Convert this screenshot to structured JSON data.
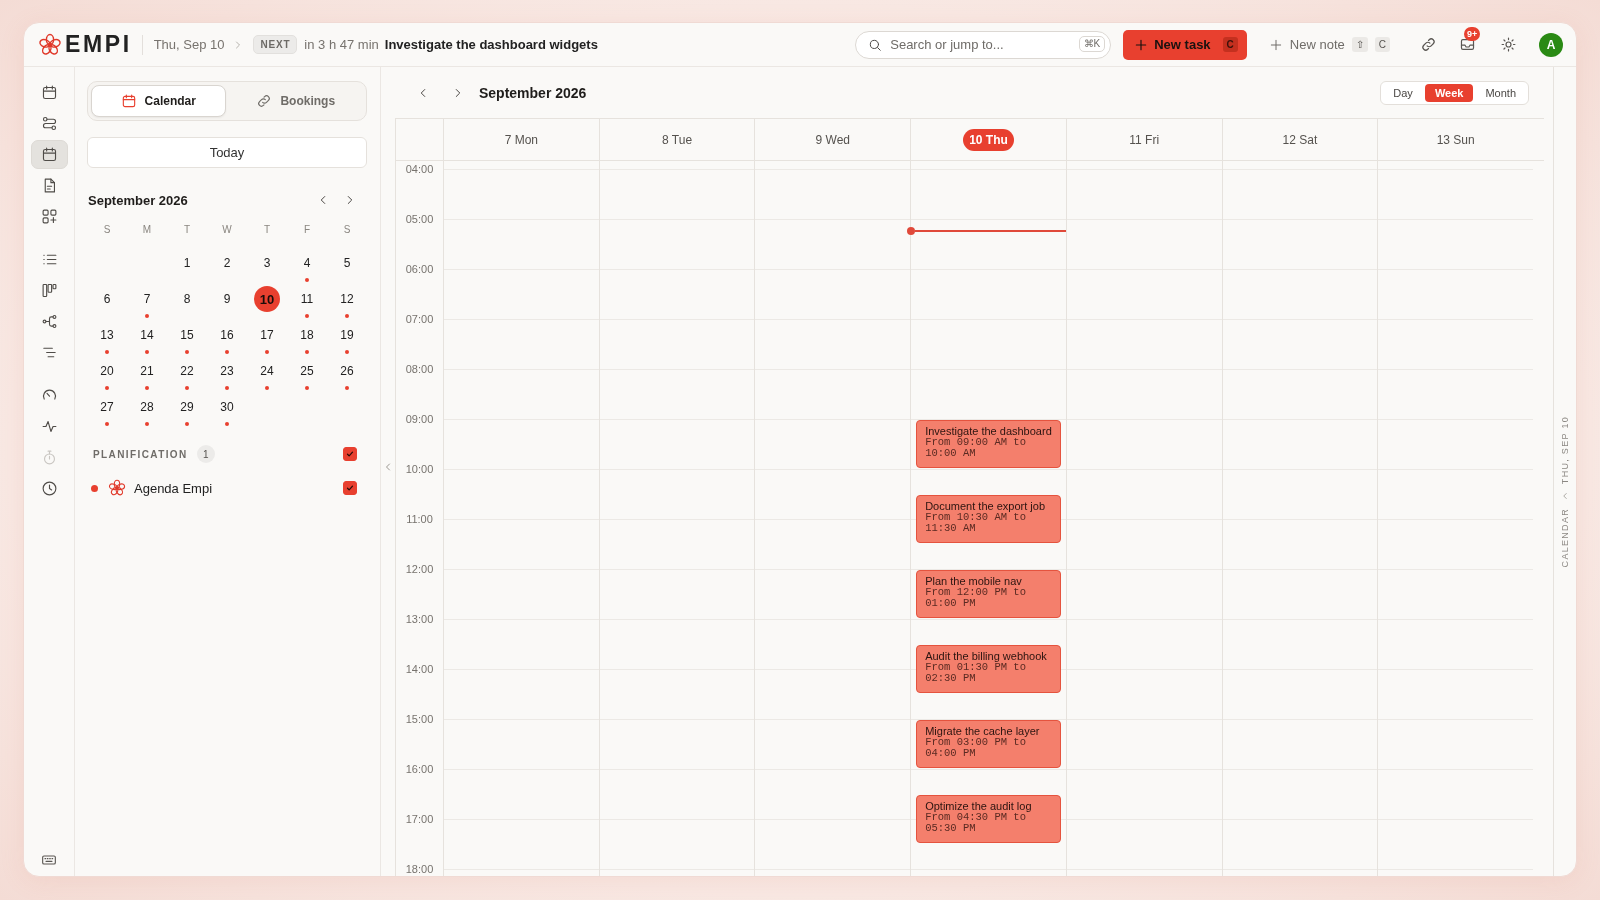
{
  "topbar": {
    "logo": "EMPI",
    "date": "Thu, Sep 10",
    "next_badge": "NEXT",
    "next_in": "in 3 h 47 min",
    "next_title": "Investigate the dashboard widgets",
    "search": {
      "placeholder": "Search or jump to...",
      "shortcut": "⌘K"
    },
    "new_task": {
      "label": "New task",
      "shortcut": "C"
    },
    "new_note": {
      "label": "New note",
      "shortcut": [
        "⇧",
        "C"
      ]
    },
    "notifications_badge": "9+",
    "avatar": "A"
  },
  "rail": {
    "groups": [
      {
        "items": [
          {
            "selected": false,
            "disabled": false
          },
          {
            "selected": false,
            "disabled": false
          },
          {
            "selected": true,
            "disabled": false
          },
          {
            "selected": false,
            "disabled": false
          },
          {
            "selected": false,
            "disabled": false
          }
        ]
      },
      {
        "items": [
          {
            "selected": false,
            "disabled": false
          },
          {
            "selected": false,
            "disabled": false
          },
          {
            "selected": false,
            "disabled": false
          },
          {
            "selected": false,
            "disabled": false
          }
        ]
      },
      {
        "items": [
          {
            "selected": false,
            "disabled": false
          },
          {
            "selected": false,
            "disabled": false
          },
          {
            "selected": false,
            "disabled": true
          },
          {
            "selected": false,
            "disabled": false
          }
        ]
      }
    ]
  },
  "sidebar": {
    "tabs": [
      {
        "label": "Calendar",
        "selected": true
      },
      {
        "label": "Bookings",
        "selected": false
      }
    ],
    "today_button": "Today",
    "mini_calendar": {
      "title": "September 2026",
      "weekdays": [
        "S",
        "M",
        "T",
        "W",
        "T",
        "F",
        "S"
      ],
      "weeks": [
        [
          {
            "kind": "blank"
          },
          {
            "kind": "blank"
          },
          {
            "kind": "day",
            "label": "1",
            "selected": false,
            "has_events": false
          },
          {
            "kind": "day",
            "label": "2",
            "selected": false,
            "has_events": false
          },
          {
            "kind": "day",
            "label": "3",
            "selected": false,
            "has_events": false
          },
          {
            "kind": "day",
            "label": "4",
            "selected": false,
            "has_events": true
          },
          {
            "kind": "day",
            "label": "5",
            "selected": false,
            "has_events": false
          }
        ],
        [
          {
            "kind": "day",
            "label": "6",
            "selected": false,
            "has_events": false
          },
          {
            "kind": "day",
            "label": "7",
            "selected": false,
            "has_events": true
          },
          {
            "kind": "day",
            "label": "8",
            "selected": false,
            "has_events": false
          },
          {
            "kind": "day",
            "label": "9",
            "selected": false,
            "has_events": false
          },
          {
            "kind": "day",
            "label": "10",
            "selected": true,
            "has_events": false
          },
          {
            "kind": "day",
            "label": "11",
            "selected": false,
            "has_events": true
          },
          {
            "kind": "day",
            "label": "12",
            "selected": false,
            "has_events": true
          }
        ],
        [
          {
            "kind": "day",
            "label": "13",
            "selected": false,
            "has_events": true
          },
          {
            "kind": "day",
            "label": "14",
            "selected": false,
            "has_events": true
          },
          {
            "kind": "day",
            "label": "15",
            "selected": false,
            "has_events": true
          },
          {
            "kind": "day",
            "label": "16",
            "selected": false,
            "has_events": true
          },
          {
            "kind": "day",
            "label": "17",
            "selected": false,
            "has_events": true
          },
          {
            "kind": "day",
            "label": "18",
            "selected": false,
            "has_events": true
          },
          {
            "kind": "day",
            "label": "19",
            "selected": false,
            "has_events": true
          }
        ],
        [
          {
            "kind": "day",
            "label": "20",
            "selected": false,
            "has_events": true
          },
          {
            "kind": "day",
            "label": "21",
            "selected": false,
            "has_events": true
          },
          {
            "kind": "day",
            "label": "22",
            "selected": false,
            "has_events": true
          },
          {
            "kind": "day",
            "label": "23",
            "selected": false,
            "has_events": true
          },
          {
            "kind": "day",
            "label": "24",
            "selected": false,
            "has_events": true
          },
          {
            "kind": "day",
            "label": "25",
            "selected": false,
            "has_events": true
          },
          {
            "kind": "day",
            "label": "26",
            "selected": false,
            "has_events": true
          }
        ],
        [
          {
            "kind": "day",
            "label": "27",
            "selected": false,
            "has_events": true
          },
          {
            "kind": "day",
            "label": "28",
            "selected": false,
            "has_events": true
          },
          {
            "kind": "day",
            "label": "29",
            "selected": false,
            "has_events": true
          },
          {
            "kind": "day",
            "label": "30",
            "selected": false,
            "has_events": true
          }
        ]
      ]
    },
    "calendars": {
      "title": "PLANIFICATION",
      "count": "1",
      "checked": true,
      "items": [
        {
          "name": "Agenda Empi",
          "color": "#e8402f",
          "checked": true
        }
      ]
    }
  },
  "calendar": {
    "title": "September 2026",
    "views": [
      {
        "label": "Day",
        "selected": false
      },
      {
        "label": "Week",
        "selected": true
      },
      {
        "label": "Month",
        "selected": false
      }
    ],
    "hours": [
      "04:00",
      "05:00",
      "06:00",
      "07:00",
      "08:00",
      "09:00",
      "10:00",
      "11:00",
      "12:00",
      "13:00",
      "14:00",
      "15:00",
      "16:00",
      "17:00",
      "18:00"
    ],
    "days": [
      {
        "label": "7 Mon",
        "today": false
      },
      {
        "label": "8 Tue",
        "today": false
      },
      {
        "label": "9 Wed",
        "today": false
      },
      {
        "label": "10 Thu",
        "today": true,
        "events": [
          {
            "title": "Investigate the dashboard",
            "time": "From 09:00 AM to 10:00 AM"
          },
          {
            "title": "Document the export job",
            "time": "From 10:30 AM to 11:30 AM"
          },
          {
            "title": "Plan the mobile nav",
            "time": "From 12:00 PM to 01:00 PM"
          },
          {
            "title": "Audit the billing webhook",
            "time": "From 01:30 PM to 02:30 PM"
          },
          {
            "title": "Migrate the cache layer",
            "time": "From 03:00 PM to 04:00 PM"
          },
          {
            "title": "Optimize the audit log",
            "time": "From 04:30 PM to 05:30 PM"
          }
        ]
      },
      {
        "label": "11 Fri",
        "today": false
      },
      {
        "label": "12 Sat",
        "today": false
      },
      {
        "label": "13 Sun",
        "today": false
      }
    ]
  },
  "side_panel": {
    "label": "CALENDAR",
    "date": "THU, SEP 10"
  }
}
